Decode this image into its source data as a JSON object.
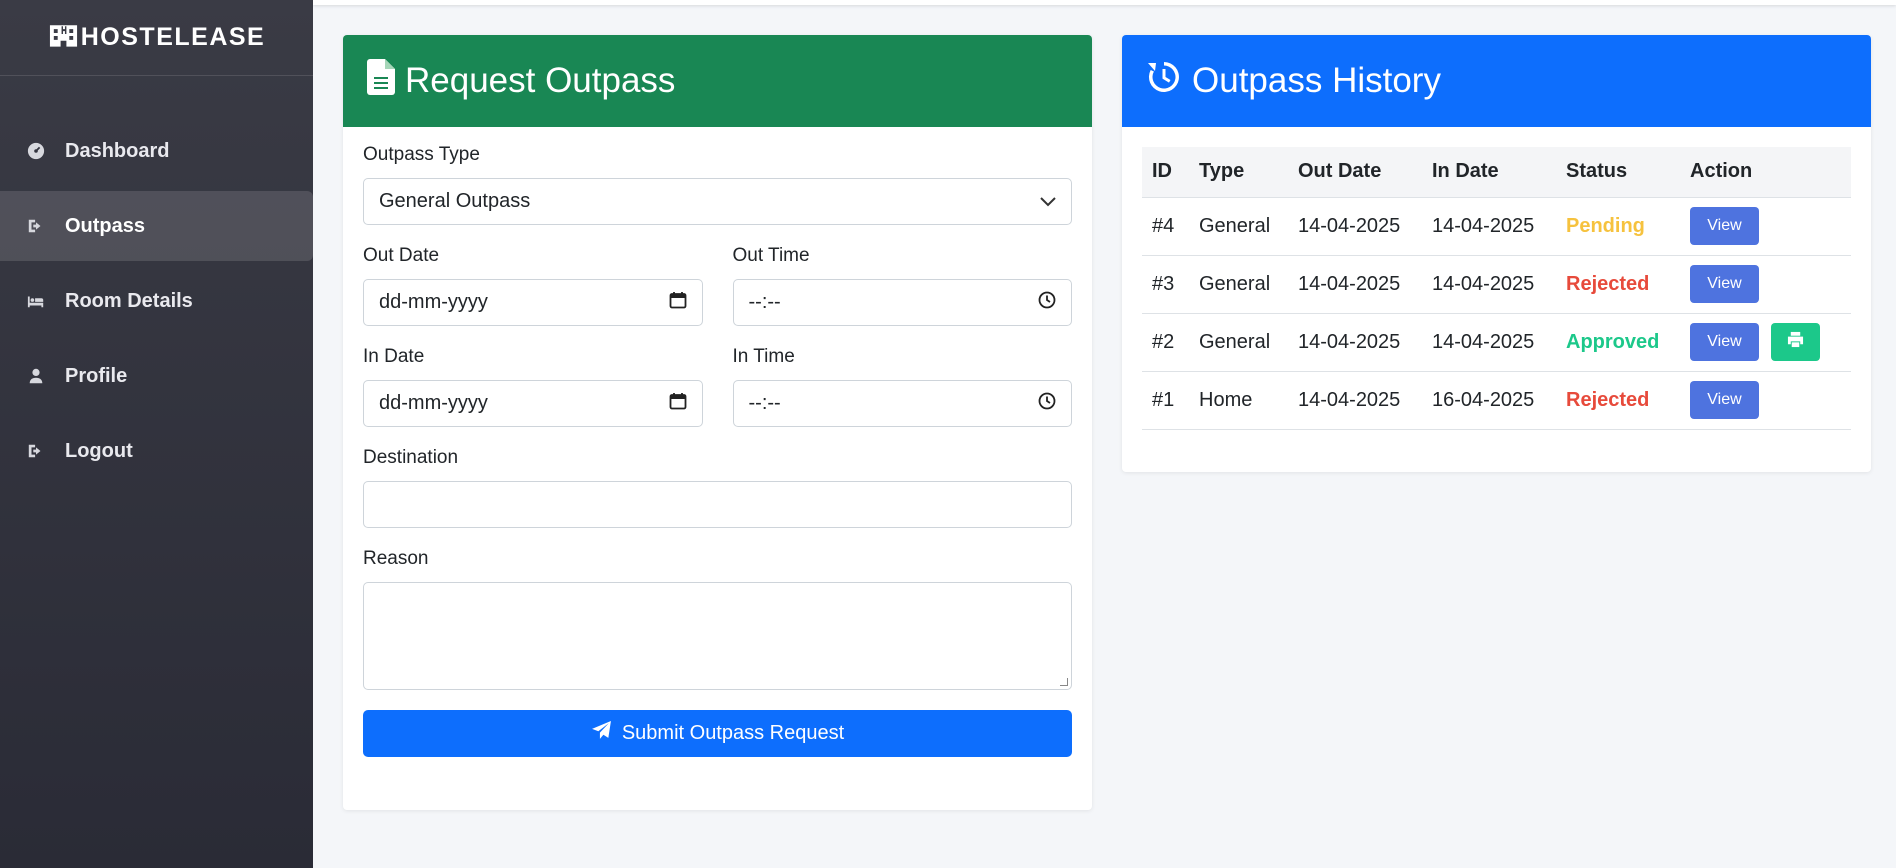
{
  "brand": {
    "name": "HOSTELEASE",
    "icon": "hotel-icon"
  },
  "sidebar": {
    "items": [
      {
        "label": "Dashboard",
        "icon": "tachometer-icon"
      },
      {
        "label": "Outpass",
        "icon": "sign-out-icon",
        "active": true
      },
      {
        "label": "Room Details",
        "icon": "bed-icon"
      },
      {
        "label": "Profile",
        "icon": "user-icon"
      },
      {
        "label": "Logout",
        "icon": "sign-out-icon"
      }
    ]
  },
  "request": {
    "title": "Request Outpass",
    "outpass_type_label": "Outpass Type",
    "outpass_type_value": "General Outpass",
    "out_date_label": "Out Date",
    "out_date_placeholder": "dd-mm-yyyy",
    "out_time_label": "Out Time",
    "out_time_placeholder": "--:--",
    "in_date_label": "In Date",
    "in_date_placeholder": "dd-mm-yyyy",
    "in_time_label": "In Time",
    "in_time_placeholder": "--:--",
    "destination_label": "Destination",
    "reason_label": "Reason",
    "submit_label": "Submit Outpass Request"
  },
  "history": {
    "title": "Outpass History",
    "columns": [
      "ID",
      "Type",
      "Out Date",
      "In Date",
      "Status",
      "Action"
    ],
    "rows": [
      {
        "id": "#4",
        "type": "General",
        "out_date": "14-04-2025",
        "in_date": "14-04-2025",
        "status": "Pending",
        "action": "View"
      },
      {
        "id": "#3",
        "type": "General",
        "out_date": "14-04-2025",
        "in_date": "14-04-2025",
        "status": "Rejected",
        "action": "View"
      },
      {
        "id": "#2",
        "type": "General",
        "out_date": "14-04-2025",
        "in_date": "14-04-2025",
        "status": "Approved",
        "action": "View"
      },
      {
        "id": "#1",
        "type": "Home",
        "out_date": "14-04-2025",
        "in_date": "16-04-2025",
        "status": "Rejected",
        "action": "View"
      }
    ]
  },
  "colors": {
    "request_header": "#198754",
    "history_header": "#0d6efd",
    "pending": "#f6c23e",
    "rejected": "#e74a3b",
    "approved": "#1cc88a",
    "view_button": "#4e73df"
  }
}
